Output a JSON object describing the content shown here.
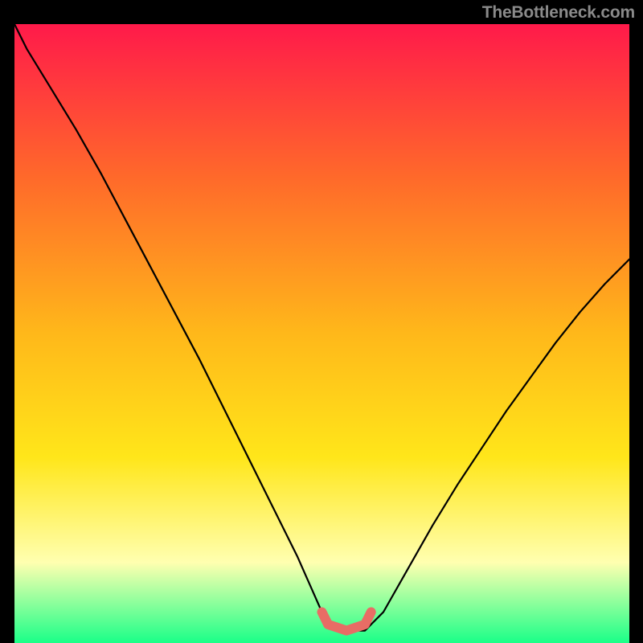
{
  "watermark": "TheBottleneck.com",
  "colors": {
    "page_bg": "#000000",
    "curve": "#000000",
    "highlight": "#e86d65",
    "gradient_top": "#ff1a4a",
    "gradient_mid1": "#ff6a2a",
    "gradient_mid2": "#ffb81a",
    "gradient_mid3": "#ffe61a",
    "gradient_pale": "#ffffb0",
    "gradient_bottom": "#1aff88"
  },
  "chart_data": {
    "type": "line",
    "title": "",
    "xlabel": "",
    "ylabel": "",
    "xlim": [
      0,
      100
    ],
    "ylim": [
      0,
      100
    ],
    "series": [
      {
        "name": "bottleneck-curve",
        "x": [
          0,
          2,
          6,
          10,
          14,
          18,
          22,
          26,
          30,
          34,
          38,
          42,
          46,
          50,
          51,
          54,
          57,
          58,
          60,
          64,
          68,
          72,
          76,
          80,
          84,
          88,
          92,
          96,
          100
        ],
        "y": [
          100,
          96,
          89.5,
          83,
          76,
          68.5,
          61,
          53.5,
          46,
          38,
          30,
          22,
          14,
          5,
          3,
          2,
          2,
          3,
          5,
          12,
          19,
          25.5,
          31.5,
          37.5,
          43,
          48.5,
          53.5,
          58,
          62
        ]
      },
      {
        "name": "ideal-band",
        "x": [
          50,
          51,
          54,
          57,
          58
        ],
        "y": [
          5,
          3,
          2,
          3,
          5
        ]
      }
    ],
    "highlight_range_x": [
      50,
      58
    ]
  }
}
